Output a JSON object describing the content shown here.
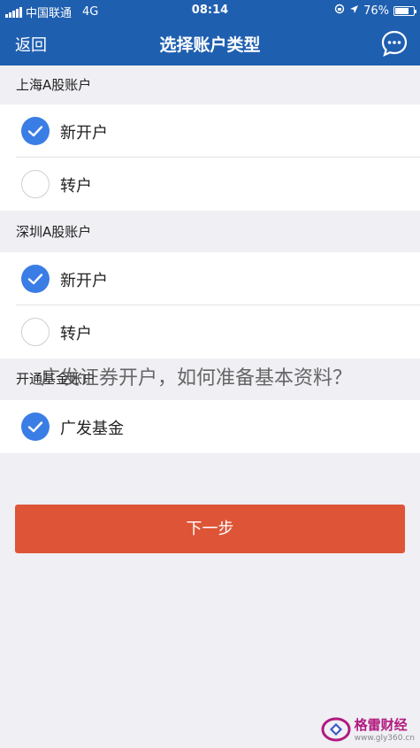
{
  "status_bar": {
    "carrier": "中国联通",
    "network": "4G",
    "time": "08:14",
    "battery": "76%",
    "battery_level": 0.76
  },
  "nav": {
    "back_label": "返回",
    "title": "选择账户类型",
    "chat_icon": "chat-bubble-icon"
  },
  "sections": [
    {
      "title": "上海A股账户",
      "options": [
        {
          "label": "新开户",
          "selected": true
        },
        {
          "label": "转户",
          "selected": false
        }
      ]
    },
    {
      "title": "深圳A股账户",
      "options": [
        {
          "label": "新开户",
          "selected": true
        },
        {
          "label": "转户",
          "selected": false
        }
      ]
    },
    {
      "title": "开通基金账户",
      "options": [
        {
          "label": "广发基金",
          "selected": true
        }
      ]
    }
  ],
  "next_button": "下一步",
  "overlay_title": "广发证券开户，如何准备基本资料？",
  "watermark": {
    "name": "格雷财经",
    "url": "www.gly360.cn"
  },
  "colors": {
    "nav_bg": "#1f5fb0",
    "radio_selected": "#3a7de5",
    "button": "#dd5536",
    "background": "#efeff4"
  }
}
